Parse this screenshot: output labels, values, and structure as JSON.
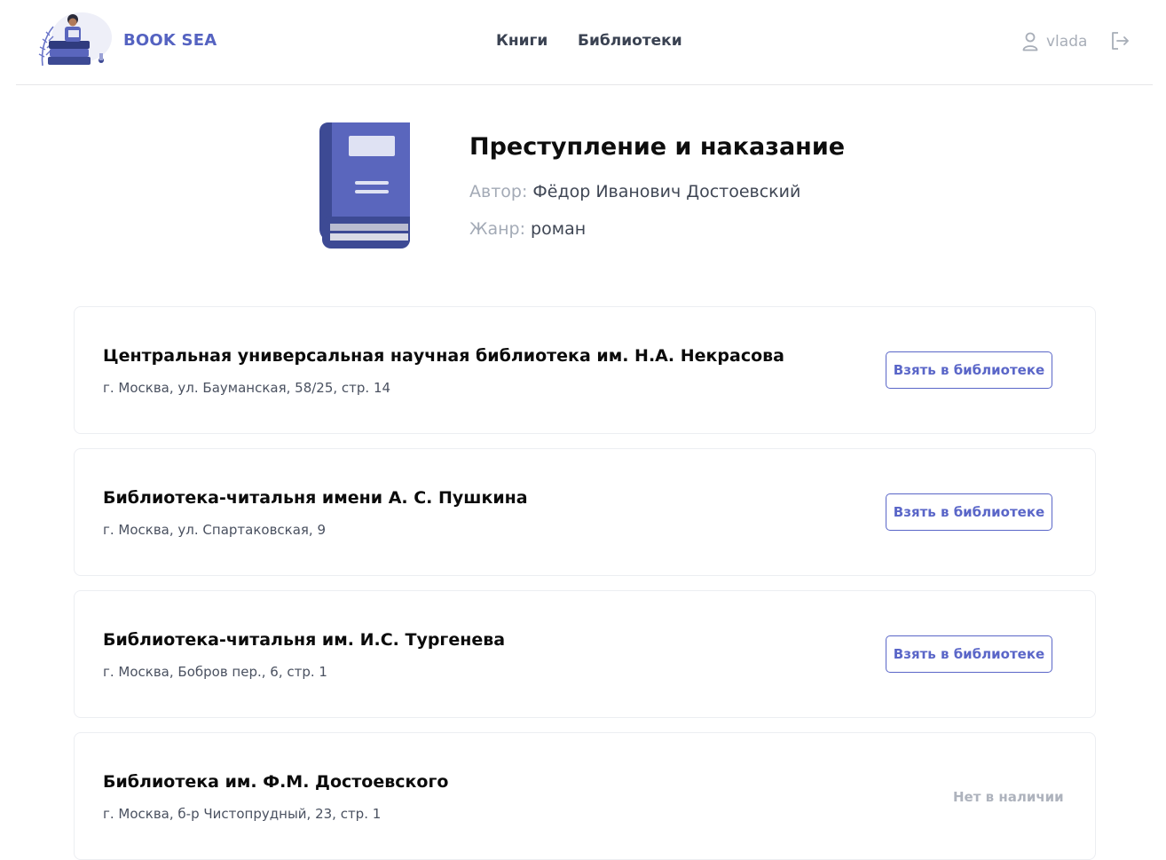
{
  "header": {
    "brand": "BOOK SEA",
    "nav": [
      "Книги",
      "Библиотеки"
    ],
    "username": "vlada",
    "icons": [
      "user-icon",
      "logout-icon"
    ]
  },
  "book": {
    "title": "Преступление и наказание",
    "author_label": "Автор:",
    "author": "Фёдор Иванович Достоевский",
    "genre_label": "Жанр:",
    "genre": "роман"
  },
  "libraries": [
    {
      "name": "Центральная универсальная научная библиотека им. Н.А. Некрасова",
      "address": "г. Москва, ул. Бауманская, 58/25, стр. 14",
      "action": "Взять в библиотеке"
    },
    {
      "name": "Библиотека-читальня имени А. С. Пушкина",
      "address": "г. Москва, ул. Спартаковская, 9",
      "action": "Взять в библиотеке"
    },
    {
      "name": "Библиотека-читальня им. И.С. Тургенева",
      "address": "г. Москва, Бобров пер., 6, стр. 1",
      "action": "Взять в библиотеке"
    },
    {
      "name": "Библиотека им. Ф.М. Достоевского",
      "address": "г. Москва, б-р Чистопрудный, 23, стр. 1",
      "status": "Нет в наличии"
    }
  ],
  "colors": {
    "accent": "#5563c1",
    "book_cover": "#5a66bd",
    "book_spine": "#3d4a94",
    "muted": "#a3aab6"
  }
}
